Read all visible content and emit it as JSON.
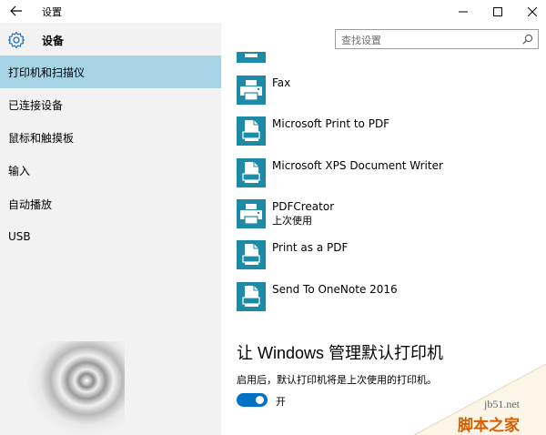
{
  "window": {
    "title": "设置",
    "controls": [
      "minimize",
      "maximize",
      "close"
    ]
  },
  "sidebar": {
    "heading": "设备",
    "items": [
      {
        "label": "打印机和扫描仪",
        "active": true
      },
      {
        "label": "已连接设备",
        "active": false
      },
      {
        "label": "鼠标和触摸板",
        "active": false
      },
      {
        "label": "输入",
        "active": false
      },
      {
        "label": "自动播放",
        "active": false
      },
      {
        "label": "USB",
        "active": false
      }
    ]
  },
  "search": {
    "placeholder": "查找设置",
    "icon": "search-icon"
  },
  "printers": [
    {
      "name": "Fax",
      "sub": "",
      "icon": "fax-icon"
    },
    {
      "name": "Microsoft Print to PDF",
      "sub": "",
      "icon": "printer-icon"
    },
    {
      "name": "Microsoft XPS Document Writer",
      "sub": "",
      "icon": "printer-icon"
    },
    {
      "name": "PDFCreator",
      "sub": "上次使用",
      "icon": "fax-icon"
    },
    {
      "name": "Print as a PDF",
      "sub": "",
      "icon": "printer-icon"
    },
    {
      "name": "Send To OneNote 2016",
      "sub": "",
      "icon": "printer-icon"
    }
  ],
  "default_printer": {
    "title": "让 Windows 管理默认打印机",
    "description": "启用后，默认打印机将是上次使用的打印机。",
    "toggle_on": true,
    "toggle_label": "开"
  },
  "watermark": {
    "site": "jb51.net",
    "brand": "脚本之家"
  },
  "colors": {
    "accent": "#0072c6",
    "icon_teal": "#1e8ba6",
    "sidebar_active": "#a6d4e6",
    "sidebar_bg": "#f2f2f2"
  }
}
